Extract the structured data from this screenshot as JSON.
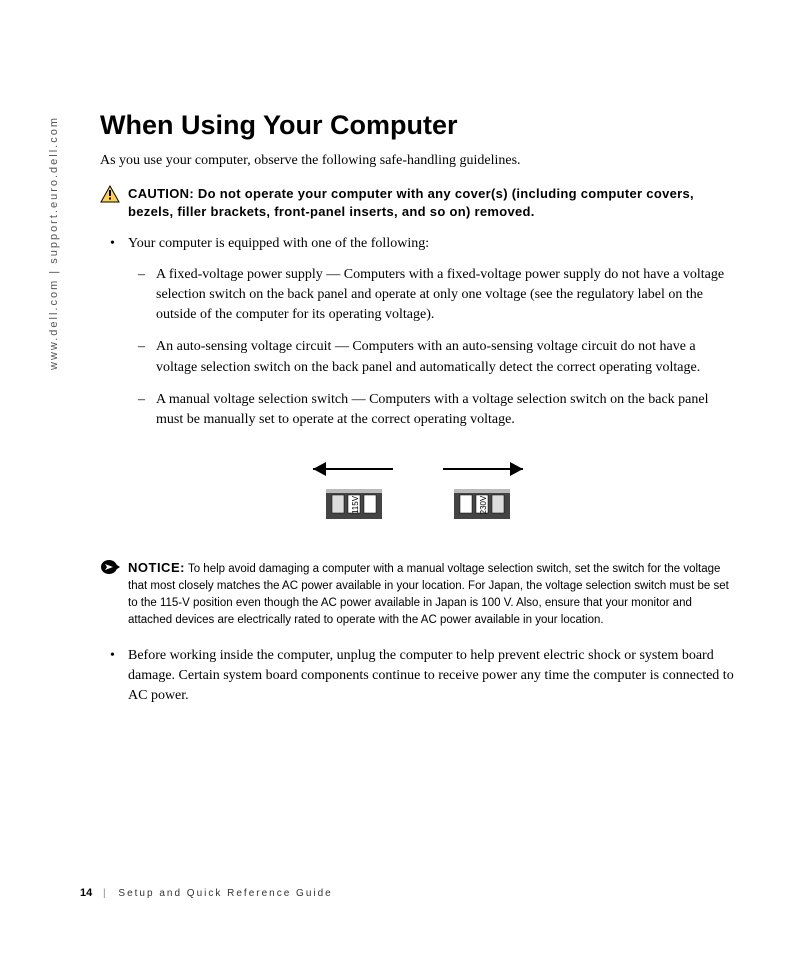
{
  "sidebar": "www.dell.com | support.euro.dell.com",
  "heading": "When Using Your Computer",
  "intro": "As you use your computer, observe the following safe-handling guidelines.",
  "caution": {
    "label": "CAUTION:",
    "text": "Do not operate your computer with any cover(s) (including computer covers, bezels, filler brackets, front-panel inserts, and so on) removed."
  },
  "bullet1": "Your computer is equipped with one of the following:",
  "dashes": [
    "A fixed-voltage power supply — Computers with a fixed-voltage power supply do not have a voltage selection switch on the back panel and operate at only one voltage (see the regulatory label on the outside of the computer for its operating voltage).",
    "An auto-sensing voltage circuit — Computers with an auto-sensing voltage circuit do not have a voltage selection switch on the back panel and automatically detect the correct operating voltage.",
    "A manual voltage selection switch — Computers with a voltage selection switch on the back panel must be manually set to operate at the correct operating voltage."
  ],
  "switch_labels": {
    "left": "115V",
    "right": "230V"
  },
  "notice": {
    "label": "NOTICE:",
    "text": "To help avoid damaging a computer with a manual voltage selection switch, set the switch for the voltage that most closely matches the AC power available in your location. For Japan, the voltage selection switch must be set to the 115-V position even though the AC power available in Japan is 100 V. Also, ensure that your monitor and attached devices are electrically rated to operate with the AC power available in your location."
  },
  "bullet2": "Before working inside the computer, unplug the computer to help prevent electric shock or system board damage. Certain system board components continue to receive power any time the computer is connected to AC power.",
  "footer": {
    "page": "14",
    "title": "Setup and Quick Reference Guide"
  }
}
